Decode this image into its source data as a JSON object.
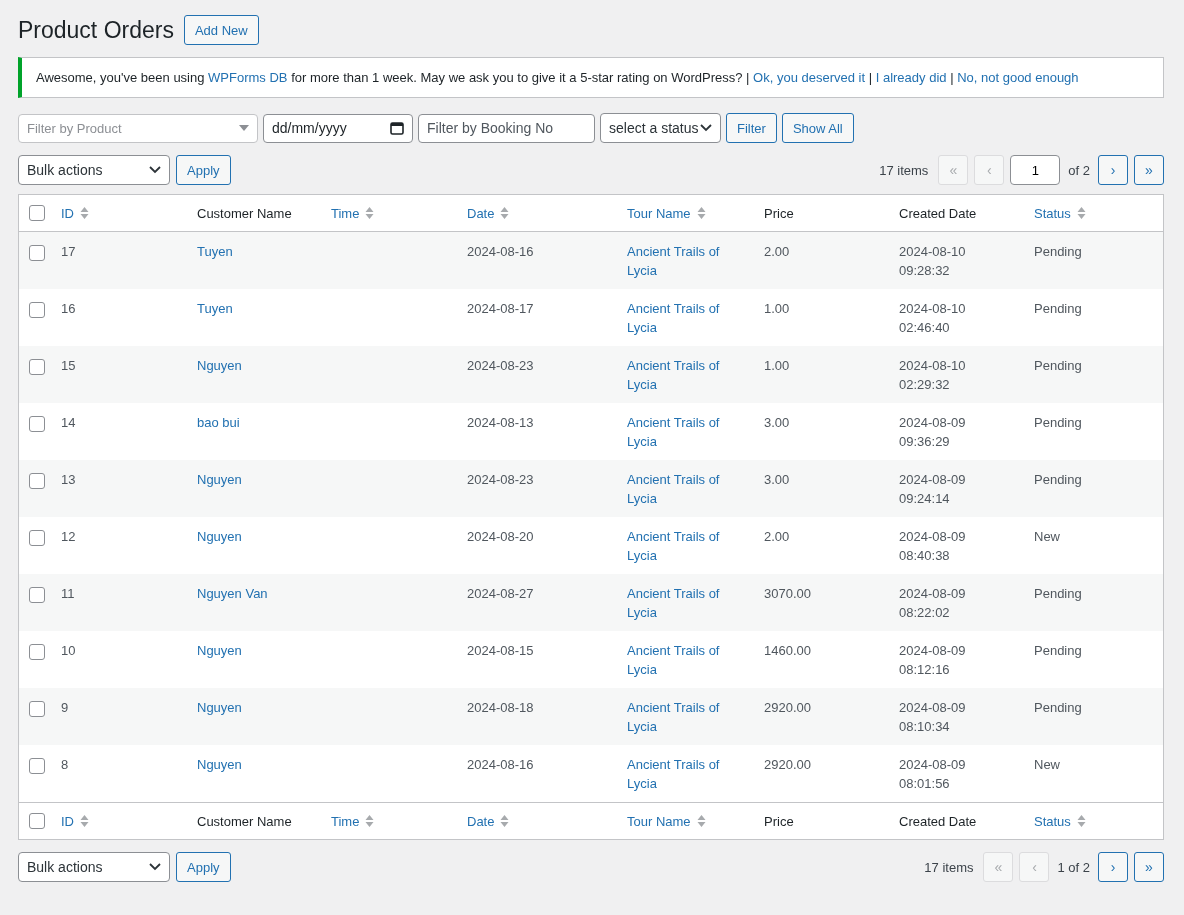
{
  "page": {
    "title": "Product Orders",
    "add_button": "Add New"
  },
  "notice": {
    "parts": [
      {
        "kind": "text",
        "text": "Awesome, you've been using "
      },
      {
        "kind": "link",
        "text": "WPForms DB"
      },
      {
        "kind": "text",
        "text": " for more than 1 week. May we ask you to give it a 5-star rating on WordPress? | "
      },
      {
        "kind": "link",
        "text": "Ok, you deserved it"
      },
      {
        "kind": "text",
        "text": " | "
      },
      {
        "kind": "link",
        "text": "I already did"
      },
      {
        "kind": "text",
        "text": " | "
      },
      {
        "kind": "link",
        "text": "No, not good enough"
      }
    ]
  },
  "filters": {
    "product": {
      "placeholder": "Filter by Product"
    },
    "date": {
      "placeholder": "dd/mm/yyyy"
    },
    "booking": {
      "placeholder": "Filter by Booking No"
    },
    "status": {
      "value": "select a status"
    },
    "buttons": [
      "Filter",
      "Show All"
    ]
  },
  "top_nav": {
    "bulk": "Bulk actions",
    "apply": "Apply",
    "count": "17 items",
    "first": "«",
    "prev": "‹",
    "page": "1",
    "of": "of 2",
    "next": "›",
    "last": "»",
    "first_disabled": true,
    "prev_disabled": true
  },
  "table": {
    "select_all_checked": false,
    "columns": [
      {
        "label": "ID",
        "sortable": true
      },
      {
        "label": "Customer Name",
        "sortable": false
      },
      {
        "label": "Time",
        "sortable": true
      },
      {
        "label": "Date",
        "sortable": true
      },
      {
        "label": "Tour Name",
        "sortable": true
      },
      {
        "label": "Price",
        "sortable": false
      },
      {
        "label": "Created Date",
        "sortable": false
      },
      {
        "label": "Status",
        "sortable": true
      }
    ],
    "rows": [
      {
        "checked": false,
        "id": "17",
        "customer": "Tuyen",
        "date": "2024-08-16",
        "tour": "Ancient Trails of Lycia",
        "price": "2.00",
        "created": "2024-08-10 09:28:32",
        "status": "Pending"
      },
      {
        "checked": false,
        "id": "16",
        "customer": "Tuyen",
        "date": "2024-08-17",
        "tour": "Ancient Trails of Lycia",
        "price": "1.00",
        "created": "2024-08-10 02:46:40",
        "status": "Pending"
      },
      {
        "checked": false,
        "id": "15",
        "customer": "Nguyen",
        "date": "2024-08-23",
        "tour": "Ancient Trails of Lycia",
        "price": "1.00",
        "created": "2024-08-10 02:29:32",
        "status": "Pending"
      },
      {
        "checked": false,
        "id": "14",
        "customer": "bao bui",
        "date": "2024-08-13",
        "tour": "Ancient Trails of Lycia",
        "price": "3.00",
        "created": "2024-08-09 09:36:29",
        "status": "Pending"
      },
      {
        "checked": false,
        "id": "13",
        "customer": "Nguyen",
        "date": "2024-08-23",
        "tour": "Ancient Trails of Lycia",
        "price": "3.00",
        "created": "2024-08-09 09:24:14",
        "status": "Pending"
      },
      {
        "checked": false,
        "id": "12",
        "customer": "Nguyen",
        "date": "2024-08-20",
        "tour": "Ancient Trails of Lycia",
        "price": "2.00",
        "created": "2024-08-09 08:40:38",
        "status": "New"
      },
      {
        "checked": false,
        "id": "11",
        "customer": "Nguyen Van",
        "date": "2024-08-27",
        "tour": "Ancient Trails of Lycia",
        "price": "3070.00",
        "created": "2024-08-09 08:22:02",
        "status": "Pending"
      },
      {
        "checked": false,
        "id": "10",
        "customer": "Nguyen",
        "date": "2024-08-15",
        "tour": "Ancient Trails of Lycia",
        "price": "1460.00",
        "created": "2024-08-09 08:12:16",
        "status": "Pending"
      },
      {
        "checked": false,
        "id": "9",
        "customer": "Nguyen",
        "date": "2024-08-18",
        "tour": "Ancient Trails of Lycia",
        "price": "2920.00",
        "created": "2024-08-09 08:10:34",
        "status": "Pending"
      },
      {
        "checked": false,
        "id": "8",
        "customer": "Nguyen",
        "date": "2024-08-16",
        "tour": "Ancient Trails of Lycia",
        "price": "2920.00",
        "created": "2024-08-09 08:01:56",
        "status": "New"
      }
    ],
    "footer_select_all_checked": false,
    "footer_columns": [
      {
        "label": "ID",
        "sortable": true
      },
      {
        "label": "Customer Name",
        "sortable": false
      },
      {
        "label": "Time",
        "sortable": true
      },
      {
        "label": "Date",
        "sortable": true
      },
      {
        "label": "Tour Name",
        "sortable": true
      },
      {
        "label": "Price",
        "sortable": false
      },
      {
        "label": "Created Date",
        "sortable": false
      },
      {
        "label": "Status",
        "sortable": true
      }
    ]
  },
  "bottom_nav": {
    "bulk": "Bulk actions",
    "apply": "Apply",
    "count": "17 items",
    "first": "«",
    "prev": "‹",
    "page_text": "1 of 2",
    "next": "›",
    "last": "»",
    "first_disabled": true,
    "prev_disabled": true
  }
}
